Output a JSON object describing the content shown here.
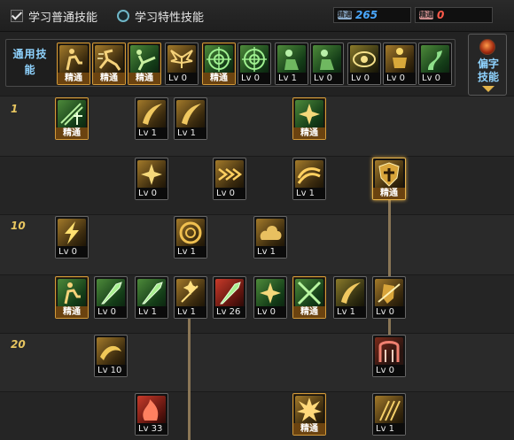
{
  "top": {
    "tab_normal": "学习普通技能",
    "tab_special": "学习特性技能",
    "points_blue_tag": "精通",
    "points_blue": "265",
    "points_red_tag": "精通",
    "points_red": "0"
  },
  "common_bar": {
    "label": "通用技能",
    "skills": [
      {
        "level": "精通",
        "icon": "figure-seated-icon",
        "tint": "gold",
        "mastered": true
      },
      {
        "level": "精通",
        "icon": "figure-dash-icon",
        "tint": "gold",
        "mastered": true
      },
      {
        "level": "精通",
        "icon": "figure-kick-icon",
        "tint": "green",
        "mastered": true
      },
      {
        "level": "Lv 0",
        "icon": "wings-icon",
        "tint": "gold",
        "mastered": false
      },
      {
        "level": "精通",
        "icon": "target-icon",
        "tint": "green",
        "mastered": true
      },
      {
        "level": "Lv 0",
        "icon": "target-icon",
        "tint": "green",
        "mastered": false
      },
      {
        "level": "Lv 1",
        "icon": "figure-crouch-icon",
        "tint": "green",
        "mastered": false
      },
      {
        "level": "Lv 0",
        "icon": "figure-crouch-icon",
        "tint": "green",
        "mastered": false
      },
      {
        "level": "Lv 0",
        "icon": "eye-icon",
        "tint": "olive",
        "mastered": false
      },
      {
        "level": "Lv 0",
        "icon": "armor-figure-icon",
        "tint": "gold",
        "mastered": false
      },
      {
        "level": "Lv 0",
        "icon": "dragon-icon",
        "tint": "green",
        "mastered": false
      }
    ]
  },
  "side_panel": {
    "label_1": "偏字",
    "label_2": "技能"
  },
  "tree": {
    "row_labels": [
      "1",
      "10",
      "20"
    ],
    "skills": [
      {
        "level": "精通",
        "icon": "slash-text-icon",
        "tint": "green",
        "mastered": true
      },
      {
        "level": "Lv 1",
        "icon": "crescent-slash-icon",
        "tint": "gold"
      },
      {
        "level": "Lv 1",
        "icon": "crescent-slash-icon",
        "tint": "gold"
      },
      {
        "level": "精通",
        "icon": "burst-icon",
        "tint": "green",
        "mastered": true
      },
      {
        "level": "Lv 0",
        "icon": "burst-icon",
        "tint": "gold"
      },
      {
        "level": "Lv 0",
        "icon": "arrows-icon",
        "tint": "gold"
      },
      {
        "level": "Lv 1",
        "icon": "wave-slash-icon",
        "tint": "gold"
      },
      {
        "level": "精通",
        "icon": "shield-cross-icon",
        "tint": "gold",
        "mastered": true
      },
      {
        "level": "Lv 0",
        "icon": "lightning-icon",
        "tint": "gold"
      },
      {
        "level": "Lv 1",
        "icon": "whirl-icon",
        "tint": "gold"
      },
      {
        "level": "Lv 1",
        "icon": "cloud-icon",
        "tint": "gold"
      },
      {
        "level": "精通",
        "icon": "figure-seated-icon",
        "tint": "green",
        "mastered": true
      },
      {
        "level": "Lv 0",
        "icon": "blade-icon",
        "tint": "green"
      },
      {
        "level": "Lv 1",
        "icon": "blade-icon",
        "tint": "green"
      },
      {
        "level": "Lv 1",
        "icon": "sparkle-icon",
        "tint": "gold"
      },
      {
        "level": "Lv 26",
        "icon": "blade-icon",
        "tint": "red"
      },
      {
        "level": "Lv 0",
        "icon": "burst-icon",
        "tint": "green"
      },
      {
        "level": "精通",
        "icon": "cross-blades-icon",
        "tint": "green",
        "mastered": true
      },
      {
        "level": "Lv 1",
        "icon": "crescent-slash-icon",
        "tint": "olive"
      },
      {
        "level": "Lv 0",
        "icon": "shield-slash-icon",
        "tint": "gold"
      },
      {
        "level": "Lv 10",
        "icon": "curve-slash-icon",
        "tint": "gold"
      },
      {
        "level": "Lv 0",
        "icon": "gate-icon",
        "tint": "redframe"
      },
      {
        "level": "Lv 33",
        "icon": "flame-slash-icon",
        "tint": "red"
      },
      {
        "level": "精通",
        "icon": "explosion-icon",
        "tint": "gold",
        "mastered": true
      },
      {
        "level": "Lv 1",
        "icon": "rain-slash-icon",
        "tint": "gold"
      }
    ]
  }
}
